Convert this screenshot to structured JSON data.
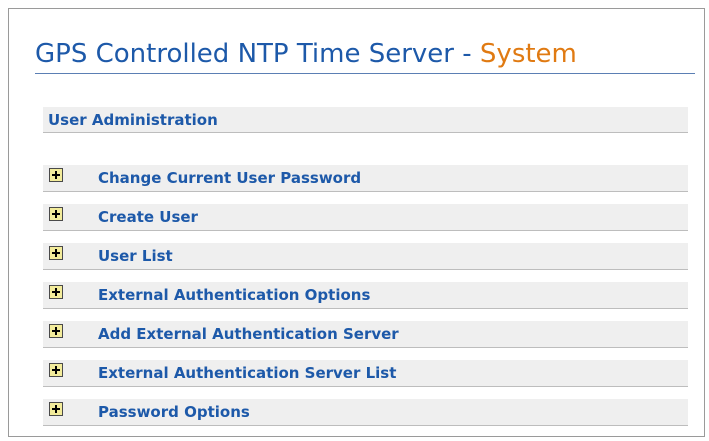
{
  "header": {
    "title_main": "GPS Controlled NTP Time Server - ",
    "title_accent": "System"
  },
  "section": {
    "title": "User Administration"
  },
  "items": [
    {
      "label": "Change Current User Password",
      "icon": "expand-plus-icon"
    },
    {
      "label": "Create User",
      "icon": "expand-plus-icon"
    },
    {
      "label": "User List",
      "icon": "expand-plus-icon"
    },
    {
      "label": "External Authentication Options",
      "icon": "expand-plus-icon"
    },
    {
      "label": "Add External Authentication Server",
      "icon": "expand-plus-icon"
    },
    {
      "label": "External Authentication Server List",
      "icon": "expand-plus-icon"
    },
    {
      "label": "Password Options",
      "icon": "expand-plus-icon"
    }
  ],
  "colors": {
    "title_blue": "#1d59a9",
    "title_accent": "#e07a12",
    "icon_fill": "#f3ec9b",
    "row_background": "#efefef"
  }
}
